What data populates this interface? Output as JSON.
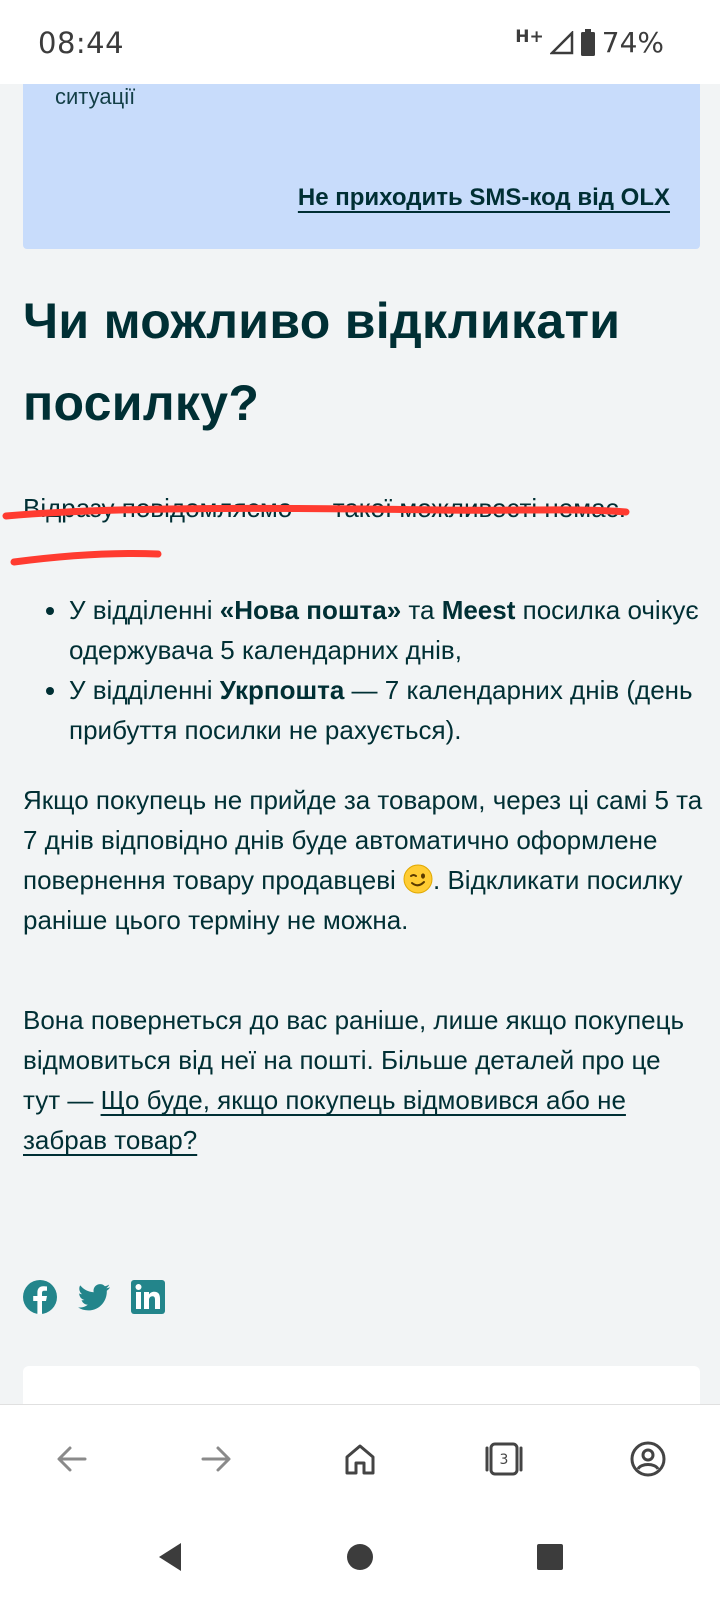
{
  "status_bar": {
    "time": "08:44",
    "network": "H+",
    "battery": "74%"
  },
  "info_box": {
    "cut_text": "ситуації",
    "link_label": "Не приходить SMS-код від OLX"
  },
  "article": {
    "title": "Чи можливо відкликати посилку?",
    "intro": "Відразу повідомляємо — такої можливості немає.",
    "bullets": [
      {
        "pre": "У відділенні ",
        "bold1": "«Нова пошта»",
        "mid": " та ",
        "bold2": "Meest",
        "post": " посилка очікує одержувача 5 календарних днів,"
      },
      {
        "pre": "У відділенні ",
        "bold1": "Укрпошта",
        "post": " — 7 календарних днів (день прибуття посилки не рахується)."
      }
    ],
    "return_text_1": "Якщо покупець не прийде за товаром, через ці самі 5 та 7 днів відповідно днів буде автоматично оформлене повернення товару продавцеві ",
    "return_text_2": ". Відкликати посилку раніше цього терміну не можна.",
    "back_text": "Вона повернеться до вас раніше, лише якщо покупець відмовиться від неї на пошті. Більше деталей про це тут — ",
    "back_link": "Що буде, якщо покупець відмовився або не забрав товар?"
  },
  "share": {
    "icons": [
      "facebook-icon",
      "twitter-icon",
      "linkedin-icon"
    ],
    "color": "#23858b"
  },
  "browser_bar": {
    "tabs_count": "3",
    "icons": [
      "back-arrow-icon",
      "forward-arrow-icon",
      "home-icon",
      "tabs-icon",
      "account-icon"
    ]
  },
  "colors": {
    "text": "#002f34",
    "info_box_bg": "#c8dcfb",
    "page_bg": "#f2f4f5",
    "highlight_underline": "#ff3b30"
  }
}
